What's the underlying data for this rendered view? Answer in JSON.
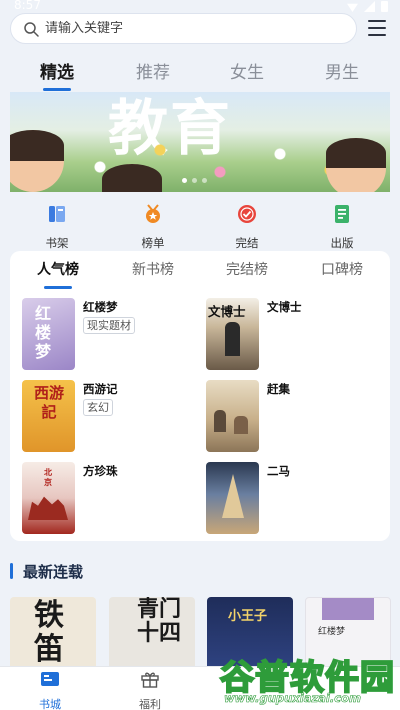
{
  "status_bar": {
    "time": "8:57"
  },
  "search": {
    "placeholder": "请输入关键字"
  },
  "top_tabs": [
    {
      "label": "精选",
      "active": true
    },
    {
      "label": "推荐",
      "active": false
    },
    {
      "label": "女生",
      "active": false
    },
    {
      "label": "男生",
      "active": false
    }
  ],
  "banner": {
    "text": "教育",
    "dots": 3,
    "active_dot": 1
  },
  "shortcuts": [
    {
      "label": "书架",
      "icon": "bookshelf-icon",
      "color": "#3b7be0"
    },
    {
      "label": "榜单",
      "icon": "medal-icon",
      "color": "#f08a24"
    },
    {
      "label": "完结",
      "icon": "completed-badge-icon",
      "color": "#e8453c"
    },
    {
      "label": "出版",
      "icon": "publish-doc-icon",
      "color": "#3bb26a"
    }
  ],
  "rank_tabs": [
    {
      "label": "人气榜",
      "active": true
    },
    {
      "label": "新书榜",
      "active": false
    },
    {
      "label": "完结榜",
      "active": false
    },
    {
      "label": "口碑榜",
      "active": false
    }
  ],
  "rank_books": [
    {
      "title": "红楼梦",
      "tag": "现实题材",
      "cover_text": "红楼梦"
    },
    {
      "title": "文博士",
      "tag": "",
      "cover_text": "文博士"
    },
    {
      "title": "西游记",
      "tag": "玄幻",
      "cover_text": "西游記"
    },
    {
      "title": "赶集",
      "tag": "",
      "cover_text": ""
    },
    {
      "title": "方珍珠",
      "tag": "",
      "cover_text": "北京"
    },
    {
      "title": "二马",
      "tag": "",
      "cover_text": ""
    }
  ],
  "latest": {
    "title": "最新连载",
    "covers": [
      {
        "cover_text": "铁笛"
      },
      {
        "cover_text": "青门十四"
      },
      {
        "cover_text": "小王子"
      },
      {
        "cover_text": "红楼梦"
      }
    ]
  },
  "bottom_nav": [
    {
      "label": "书城",
      "active": true
    },
    {
      "label": "福利",
      "active": false
    }
  ],
  "watermark": {
    "text": "谷普软件园",
    "url": "www.gupuxiazai.com"
  },
  "colors": {
    "accent": "#1f6fd8",
    "page_bg": "#eef2f8"
  }
}
